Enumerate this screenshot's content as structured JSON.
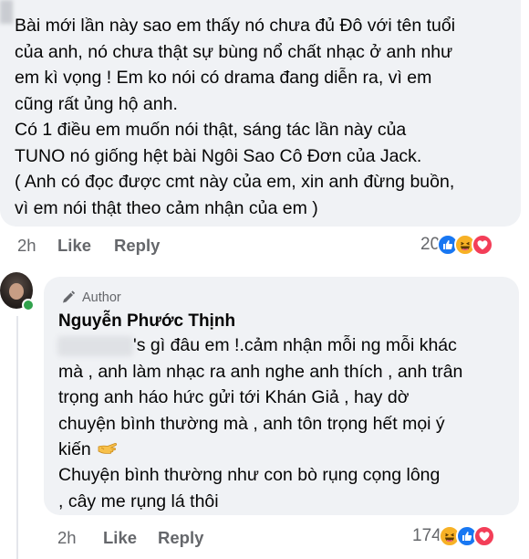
{
  "comment_1": {
    "text": "Bài mới lần này sao em thấy nó chưa đủ Đô với tên tuổi\ncủa anh, nó chưa thật sự bùng nổ chất nhạc ở anh như\nem kì vọng ! Em ko nói có drama đang diễn ra, vì em\ncũng rất ủng hộ anh.\nCó 1 điều em muốn nói thật, sáng tác lần này của\nTUNO nó giống hệt bài Ngôi Sao Cô Đơn của Jack.\n( Anh có đọc được cmt này của em, xin anh đừng buồn,\nvì em nói thật theo cảm nhận của em )",
    "time": "2h",
    "like_label": "Like",
    "reply_label": "Reply",
    "reaction_count": "20",
    "reactions": [
      "like-icon",
      "haha-icon",
      "love-icon"
    ]
  },
  "comment_2": {
    "author_badge": "Author",
    "author_name": "Nguyễn Phước Thịnh",
    "text_part_1": "'s gì đâu em !.cảm nhận mỗi ng mỗi khác\nmà , anh làm nhạc ra anh nghe anh thích , anh trân\ntrọng anh háo hức gửi tới Khán Giả , hay dờ\nchuyện bình thường mà , anh tôn trọng hết mọi ý\nkiến",
    "text_part_2": "   Chuyện bình thường như con bò rụng cọng lông\n, cây me rụng lá thôi",
    "time": "2h",
    "like_label": "Like",
    "reply_label": "Reply",
    "reaction_count": "174",
    "reactions": [
      "haha-icon",
      "like-icon",
      "love-icon"
    ]
  },
  "colors": {
    "bubble_bg": "#f0f2f5",
    "meta_text": "#65676b",
    "like_blue": "#1877f2",
    "haha_yellow": "#f7b125",
    "love_red": "#f33e58",
    "online_green": "#31a24c"
  }
}
